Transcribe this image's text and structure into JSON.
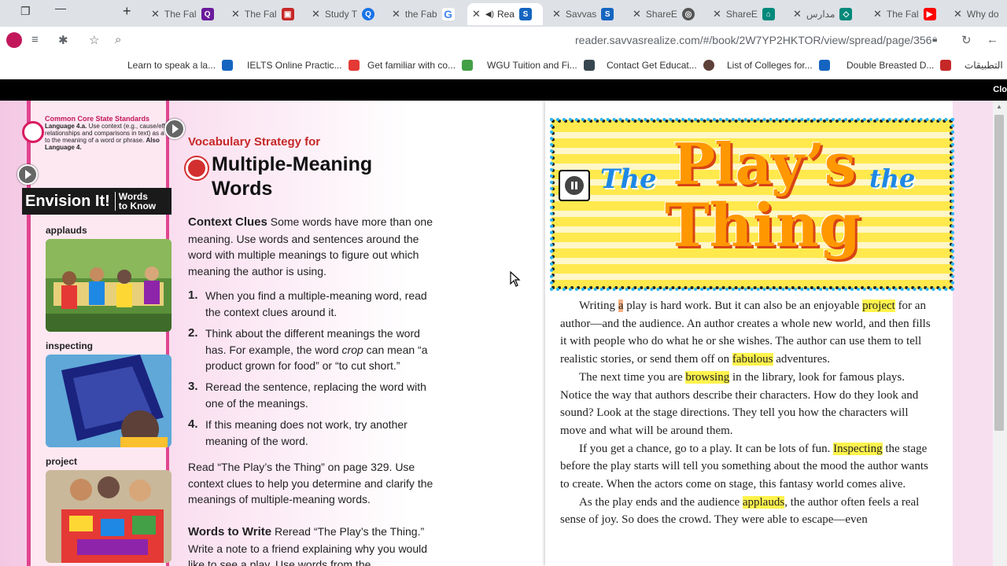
{
  "tabs": [
    {
      "title": "The Fal",
      "color": "#555"
    },
    {
      "title": "The Fal",
      "color": "#6a1b9a"
    },
    {
      "title": "Study T",
      "color": "#c62828"
    },
    {
      "title": "the Fab",
      "color": "#1a73e8"
    },
    {
      "title": "Rea",
      "color": "#fbbc04"
    },
    {
      "title": "Savvas",
      "color": "#1565c0"
    },
    {
      "title": "ShareE",
      "color": "#1565c0"
    },
    {
      "title": "ShareE",
      "color": "#555"
    },
    {
      "title": "مدارس",
      "color": "#00897b"
    },
    {
      "title": "The Fal",
      "color": "#00897b"
    },
    {
      "title": "Why do",
      "color": "#ff0000"
    }
  ],
  "address": {
    "url": "reader.savvasrealize.com/#/book/2W7YP2HKTOR/view/spread/page/356"
  },
  "bookmarks": [
    {
      "label": "Learn to speak a la...",
      "color": "#1565c0"
    },
    {
      "label": "IELTS Online Practic...",
      "color": "#e53935"
    },
    {
      "label": "Get familiar with co...",
      "color": "#43a047"
    },
    {
      "label": "WGU Tuition and Fi...",
      "color": "#37474f"
    },
    {
      "label": "Contact Get Educat...",
      "color": "#5d4037"
    },
    {
      "label": "List of Colleges for...",
      "color": "#1565c0"
    },
    {
      "label": "Double Breasted D...",
      "color": "#c62828"
    },
    {
      "label": "التطبيقات",
      "color": "#555"
    }
  ],
  "blackbar": {
    "text": "Clo"
  },
  "left": {
    "ccss_title": "Common Core State Standards",
    "ccss_text_a": "Language 4.a.",
    "ccss_text_b": " Use context (e.g., cause/effect relationships and comparisons in text) as a clue to the meaning of a word or phrase. ",
    "ccss_text_c": "Also Language 4.",
    "envision_a": "Envision It!",
    "envision_b": "Words",
    "envision_c": "to Know",
    "words": [
      "applauds",
      "inspecting",
      "project"
    ],
    "vs_title": "Vocabulary Strategy for",
    "mm_title": "Multiple-Meaning Words",
    "context_head": "Context Clues",
    "context_text": " Some words have more than one meaning. Use words and sentences around the word with multiple meanings to figure out which meaning the author is using.",
    "steps": [
      {
        "num": "1.",
        "text": "When you find a multiple-meaning word, read the context clues around it."
      },
      {
        "num": "2.",
        "text_a": "Think about the different meanings the word has. For example, the word ",
        "text_em": "crop",
        "text_b": " can mean “a product grown for food” or “to cut short.”"
      },
      {
        "num": "3.",
        "text": "Reread the sentence, replacing the word with one of the meanings."
      },
      {
        "num": "4.",
        "text": "If this meaning does not work, try another meaning of the word."
      }
    ],
    "read_text": "Read “The Play’s the Thing” on page 329. Use context clues to help you determine and clarify the meanings of multiple-meaning words.",
    "wtw_head": "Words to Write",
    "wtw_text": " Reread “The Play’s the Thing.” Write a note to a friend explaining why you would like to see a play. Use words from the"
  },
  "right": {
    "banner_the1": "The",
    "banner_plays": "Play’s",
    "banner_the2": "the",
    "banner_thing": "Thing",
    "p1": [
      "Writing ",
      "a",
      " play is hard work. But it can also be an enjoyable ",
      "project",
      " for an author—and the audience. An author creates a whole new world, and then fills it with people who do what he or she wishes. The author can use them to tell realistic stories, or send them off on ",
      "fabulous",
      " adventures."
    ],
    "p2": [
      "The next time you are ",
      "browsing",
      " in the library, look for famous plays. Notice the way that authors describe their characters. How do they look and sound? Look at the stage directions. They tell you how the characters will move and what will be around them."
    ],
    "p3": [
      "If you get a chance, go to a play. It can be lots of fun. ",
      "Inspecting",
      " the stage before the play starts will tell you something about the mood the author wants to create. When the actors come on stage, this fantasy world comes alive."
    ],
    "p4": [
      "As the play ends and the audience ",
      "applauds",
      ", the author often feels a real sense of joy. So does the crowd. They were able to escape—even"
    ]
  }
}
